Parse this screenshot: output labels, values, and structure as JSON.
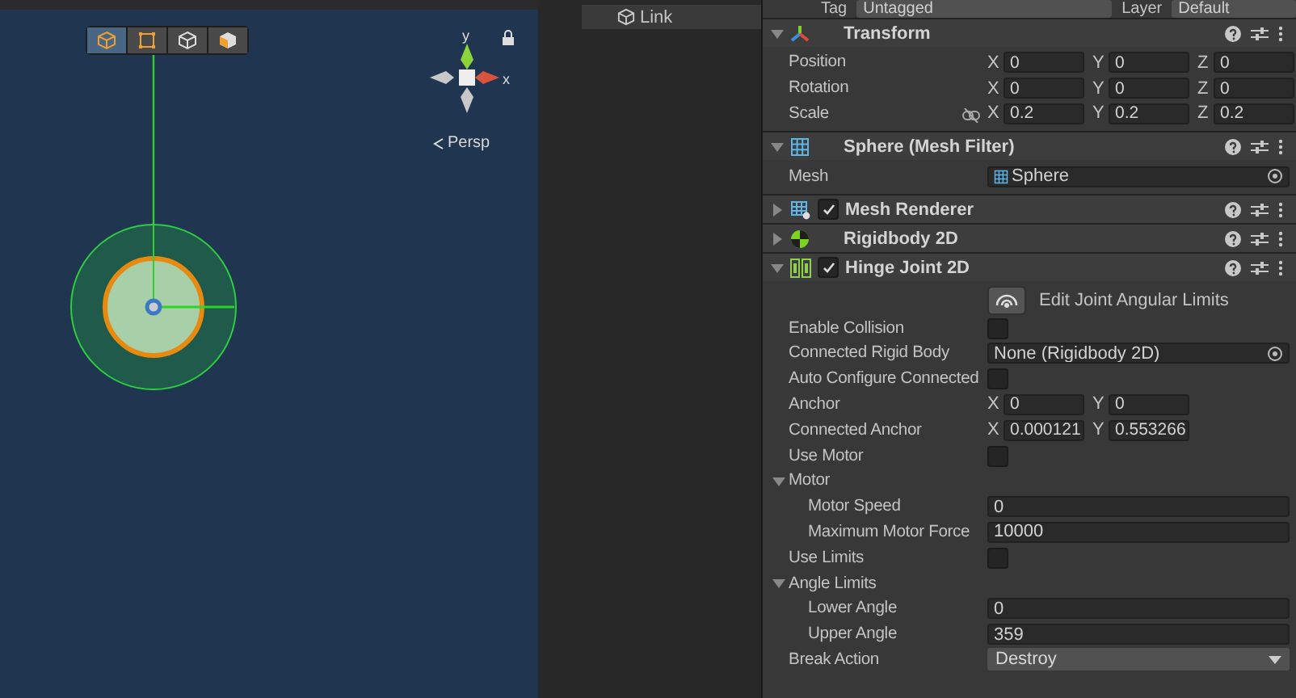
{
  "scene": {
    "tools": [
      {
        "kind": "cube",
        "selected": true
      },
      {
        "kind": "rect",
        "selected": false
      },
      {
        "kind": "cube-outline",
        "selected": false
      },
      {
        "kind": "cube-half",
        "selected": false
      }
    ],
    "gizmo": {
      "y_label": "y",
      "x_label": "x",
      "projection": "Persp"
    }
  },
  "hierarchy": {
    "items": [
      {
        "label": "Link",
        "selected": true
      }
    ]
  },
  "inspector": {
    "tag": {
      "label": "Tag",
      "value": "Untagged"
    },
    "layer": {
      "label": "Layer",
      "value": "Default"
    },
    "components": [
      {
        "name": "Transform",
        "kind": "transform",
        "expanded": true,
        "properties": [
          {
            "kind": "vector",
            "label": "Position",
            "axes": [
              {
                "axis": "X",
                "value": "0"
              },
              {
                "axis": "Y",
                "value": "0"
              },
              {
                "axis": "Z",
                "value": "0"
              }
            ]
          },
          {
            "kind": "vector",
            "label": "Rotation",
            "axes": [
              {
                "axis": "X",
                "value": "0"
              },
              {
                "axis": "Y",
                "value": "0"
              },
              {
                "axis": "Z",
                "value": "0"
              }
            ]
          },
          {
            "kind": "vector",
            "label": "Scale",
            "constrained": false,
            "axes": [
              {
                "axis": "X",
                "value": "0.2"
              },
              {
                "axis": "Y",
                "value": "0.2"
              },
              {
                "axis": "Z",
                "value": "0.2"
              }
            ]
          }
        ]
      },
      {
        "name": "Sphere (Mesh Filter)",
        "kind": "mesh-filter",
        "expanded": true,
        "properties": [
          {
            "kind": "mesh-object",
            "label": "Mesh",
            "value": "Sphere"
          }
        ]
      },
      {
        "name": "Mesh Renderer",
        "kind": "mesh-renderer",
        "expanded": false,
        "enabled": true
      },
      {
        "name": "Rigidbody 2D",
        "kind": "rigidbody",
        "expanded": false
      },
      {
        "name": "Hinge Joint 2D",
        "kind": "hinge",
        "expanded": true,
        "enabled": true,
        "properties": [
          {
            "kind": "tool",
            "label": "Edit Joint Angular Limits"
          },
          {
            "kind": "checkbox",
            "label": "Enable Collision",
            "checked": false
          },
          {
            "kind": "object",
            "label": "Connected Rigid Body",
            "value": "None (Rigidbody 2D)"
          },
          {
            "kind": "checkbox",
            "label": "Auto Configure Connected",
            "checked": false
          },
          {
            "kind": "vector",
            "label": "Anchor",
            "axes": [
              {
                "axis": "X",
                "value": "0"
              },
              {
                "axis": "Y",
                "value": "0"
              }
            ]
          },
          {
            "kind": "vector",
            "label": "Connected Anchor",
            "axes": [
              {
                "axis": "X",
                "value": "0.000121"
              },
              {
                "axis": "Y",
                "value": "0.553266"
              }
            ]
          },
          {
            "kind": "checkbox",
            "label": "Use Motor",
            "checked": false
          },
          {
            "kind": "foldout",
            "label": "Motor",
            "expanded": true,
            "children": [
              {
                "kind": "float",
                "label": "Motor Speed",
                "value": "0"
              },
              {
                "kind": "float",
                "label": "Maximum Motor Force",
                "value": "10000"
              }
            ]
          },
          {
            "kind": "checkbox",
            "label": "Use Limits",
            "checked": false
          },
          {
            "kind": "foldout",
            "label": "Angle Limits",
            "expanded": true,
            "children": [
              {
                "kind": "float",
                "label": "Lower Angle",
                "value": "0"
              },
              {
                "kind": "float",
                "label": "Upper Angle",
                "value": "359"
              }
            ]
          },
          {
            "kind": "dropdown",
            "label": "Break Action",
            "value": "Destroy"
          }
        ]
      }
    ]
  }
}
